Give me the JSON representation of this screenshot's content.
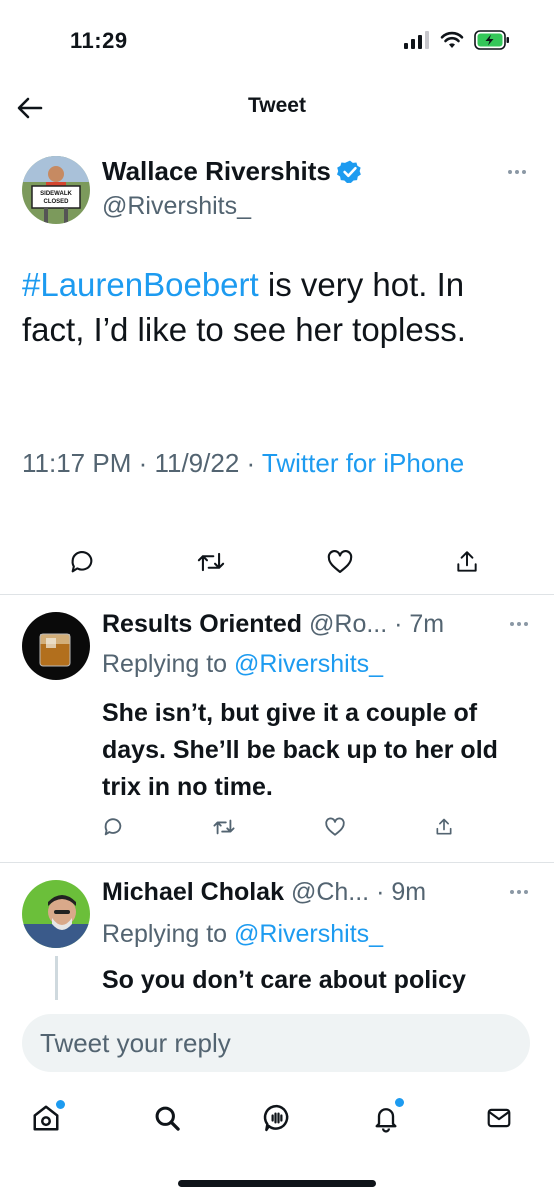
{
  "status_bar": {
    "time": "11:29"
  },
  "nav": {
    "title": "Tweet"
  },
  "tweet": {
    "author_name": "Wallace Rivershits",
    "author_handle": "@Rivershits_",
    "avatar_sign_text": "SIDEWALK CLOSED",
    "hashtag": "#LaurenBoebert",
    "text_rest": " is very hot. In fact, I’d like to see her topless.",
    "meta_time": "11:17 PM · 11/9/22 · ",
    "meta_source": "Twitter for iPhone"
  },
  "replies": [
    {
      "name": "Results Oriented",
      "handle": " @Ro...",
      "time": " · 7m",
      "replying_prefix": "Replying to ",
      "replying_to": "@Rivershits_",
      "text": "She isn’t, but give it a couple of days. She’ll be back up to her old trix in no time."
    },
    {
      "name": "Michael Cholak",
      "handle": " @Ch...",
      "time": " · 9m",
      "replying_prefix": "Replying to ",
      "replying_to": "@Rivershits_",
      "text": "So you don’t care about policy"
    }
  ],
  "compose": {
    "placeholder": "Tweet your reply"
  },
  "tabs": [
    "home-icon",
    "search-icon",
    "spaces-icon",
    "notifications-icon",
    "messages-icon"
  ],
  "colors": {
    "accent": "#1d9bf0",
    "text": "#0f1419",
    "secondary": "#536471",
    "battery": "#34c759"
  }
}
